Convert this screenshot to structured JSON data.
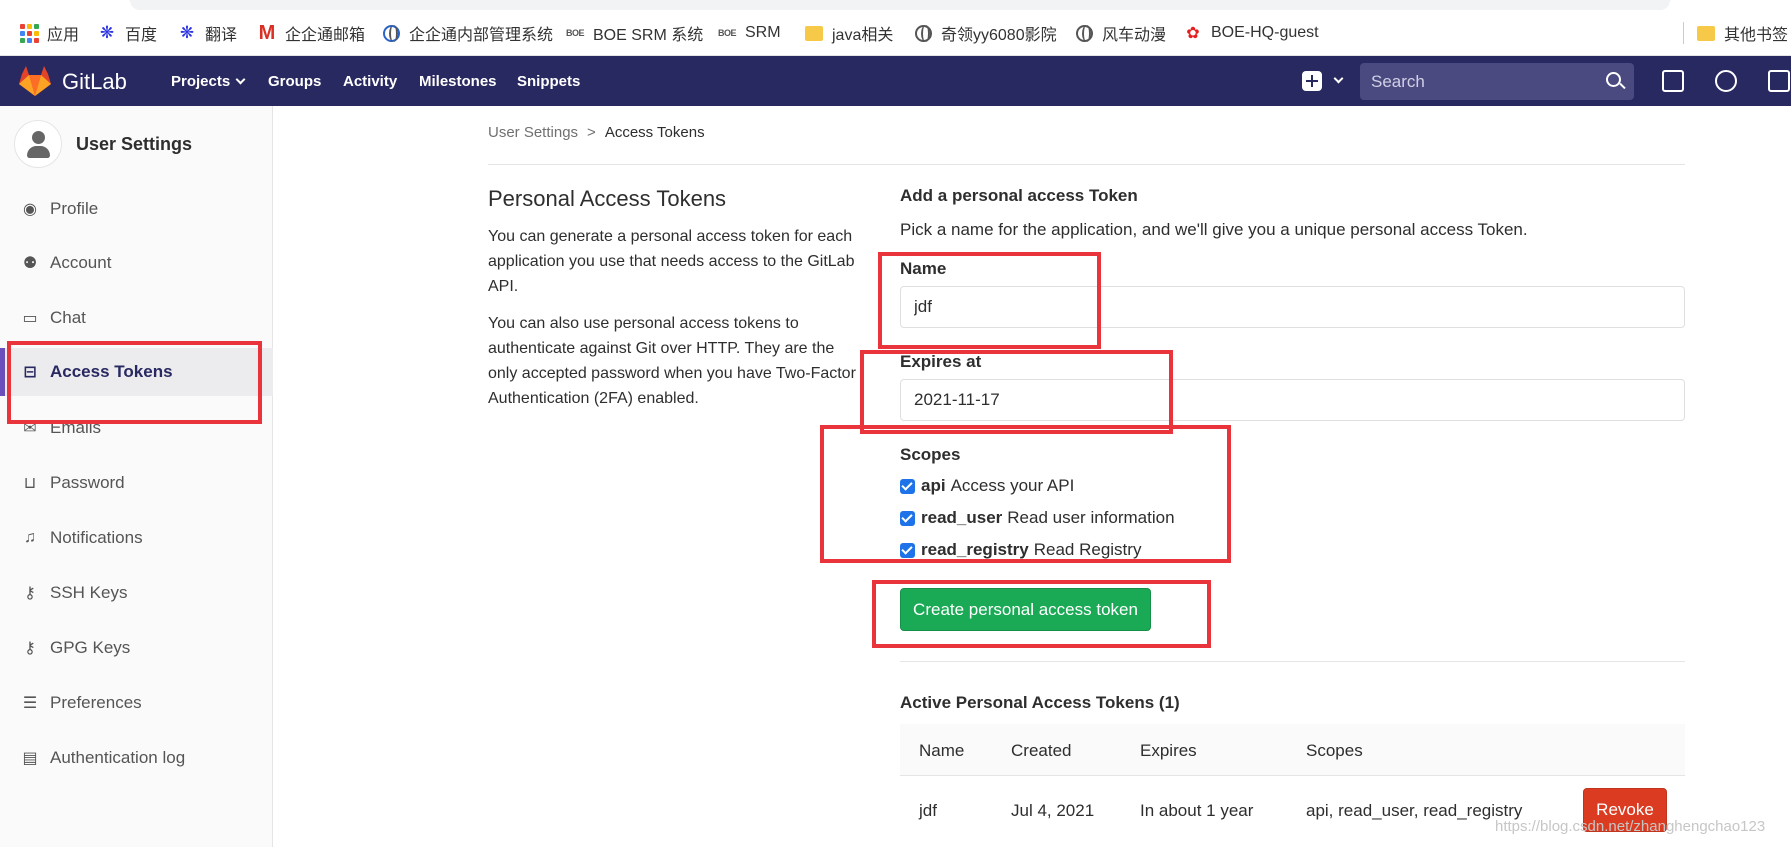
{
  "bookmarks": [
    {
      "label": "应用",
      "icon": "apps-grid-icon"
    },
    {
      "label": "百度",
      "icon": "baidu-paw-icon"
    },
    {
      "label": "翻译",
      "icon": "baidu-paw-icon"
    },
    {
      "label": "企企通邮箱",
      "icon": "mail-m-icon"
    },
    {
      "label": "企企通内部管理系统",
      "icon": "globe-icon"
    },
    {
      "label": "BOE SRM 系统",
      "icon": "boe-icon"
    },
    {
      "label": "SRM",
      "icon": "boe-icon"
    },
    {
      "label": "java相关",
      "icon": "folder-icon"
    },
    {
      "label": "奇领yy6080影院",
      "icon": "globe-icon"
    },
    {
      "label": "风车动漫",
      "icon": "globe-icon"
    },
    {
      "label": "BOE-HQ-guest",
      "icon": "huawei-icon"
    }
  ],
  "bookmarks_other": "其他书签",
  "boe_glyph": "BOE",
  "navbar": {
    "brand": "GitLab",
    "links": [
      "Projects",
      "Groups",
      "Activity",
      "Milestones",
      "Snippets"
    ],
    "search_placeholder": "Search"
  },
  "sidebar": {
    "title": "User Settings",
    "items": [
      {
        "label": "Profile",
        "icon": "profile-icon"
      },
      {
        "label": "Account",
        "icon": "account-icon"
      },
      {
        "label": "Chat",
        "icon": "chat-icon"
      },
      {
        "label": "Access Tokens",
        "icon": "token-icon",
        "active": true
      },
      {
        "label": "Emails",
        "icon": "email-icon"
      },
      {
        "label": "Password",
        "icon": "lock-icon"
      },
      {
        "label": "Notifications",
        "icon": "bell-icon"
      },
      {
        "label": "SSH Keys",
        "icon": "key-icon"
      },
      {
        "label": "GPG Keys",
        "icon": "key-icon"
      },
      {
        "label": "Preferences",
        "icon": "sliders-icon"
      },
      {
        "label": "Authentication log",
        "icon": "log-icon"
      }
    ]
  },
  "breadcrumb": {
    "parent": "User Settings",
    "sep": ">",
    "current": "Access Tokens"
  },
  "left": {
    "title": "Personal Access Tokens",
    "p1": "You can generate a personal access token for each application you use that needs access to the GitLab API.",
    "p2": "You can also use personal access tokens to authenticate against Git over HTTP. They are the only accepted password when you have Two-Factor Authentication (2FA) enabled."
  },
  "form": {
    "title": "Add a personal access Token",
    "description": "Pick a name for the application, and we'll give you a unique personal access Token.",
    "name_label": "Name",
    "name_value": "jdf",
    "expires_label": "Expires at",
    "expires_value": "2021-11-17",
    "scopes_label": "Scopes",
    "scopes": [
      {
        "name": "api",
        "desc": "Access your API",
        "checked": true
      },
      {
        "name": "read_user",
        "desc": "Read user information",
        "checked": true
      },
      {
        "name": "read_registry",
        "desc": "Read Registry",
        "checked": true
      }
    ],
    "submit_label": "Create personal access token"
  },
  "active_tokens": {
    "title": "Active Personal Access Tokens (1)",
    "columns": [
      "Name",
      "Created",
      "Expires",
      "Scopes"
    ],
    "rows": [
      {
        "name": "jdf",
        "created": "Jul 4, 2021",
        "expires": "In about 1 year",
        "scopes": "api, read_user, read_registry",
        "action": "Revoke"
      }
    ]
  },
  "watermark": "https://blog.csdn.net/zhanghengchao123",
  "colors": {
    "navbar": "#292961",
    "create_button": "#1aaa55",
    "revoke_button": "#db3b21",
    "annotation": "#e8343a"
  }
}
